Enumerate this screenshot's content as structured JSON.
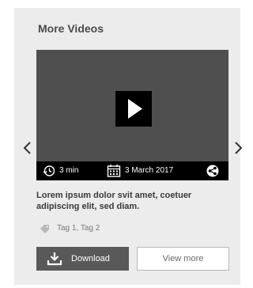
{
  "widget": {
    "title": "More Videos"
  },
  "video": {
    "duration": "3 min",
    "date": "3 March 2017",
    "description": "Lorem ipsum dolor svit amet, coetuer adipiscing elit, sed diam.",
    "tags": "Tag 1, Tag 2"
  },
  "actions": {
    "download_label": "Download",
    "view_more_label": "View more"
  },
  "colors": {
    "panel": "#ececec",
    "video_bg": "#4f4f4f",
    "meta_bar": "#000000",
    "download_button": "#595959"
  },
  "icons": {
    "play": "play-icon",
    "duration": "clock-icon",
    "date": "calendar-icon",
    "share": "share-icon",
    "tag": "tag-icon",
    "download": "download-icon",
    "prev": "chevron-left-icon",
    "next": "chevron-right-icon"
  }
}
